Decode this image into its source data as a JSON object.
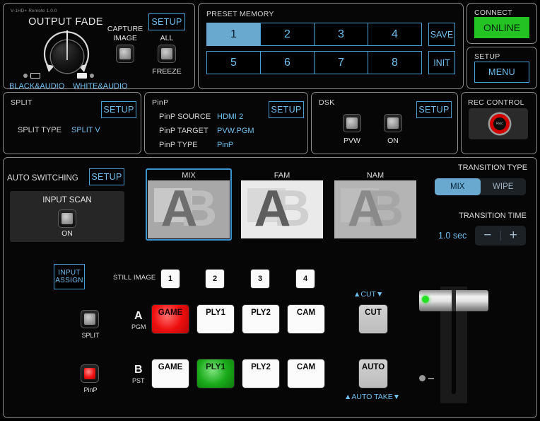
{
  "app": {
    "version": "V-1HD+ Remote 1.0.0"
  },
  "output_fade": {
    "title": "OUTPUT FADE",
    "left_label": "BLACK&AUDIO",
    "right_label": "WHITE&AUDIO"
  },
  "capture": {
    "line1": "CAPTURE",
    "line2": "IMAGE"
  },
  "freeze": {
    "setup_label": "SETUP",
    "all_label": "ALL",
    "freeze_label": "FREEZE"
  },
  "preset_memory": {
    "title": "PRESET MEMORY",
    "buttons": [
      "1",
      "2",
      "3",
      "4",
      "5",
      "6",
      "7",
      "8"
    ],
    "selected": "1",
    "save_label": "SAVE",
    "init_label": "INIT"
  },
  "connect": {
    "title": "CONNECT",
    "status": "ONLINE",
    "status_color": "#22c322"
  },
  "setup_menu": {
    "title": "SETUP",
    "menu_label": "MENU"
  },
  "split": {
    "title": "SPLIT",
    "setup_label": "SETUP",
    "type_key": "SPLIT TYPE",
    "type_value": "SPLIT V"
  },
  "pinp": {
    "title": "PinP",
    "setup_label": "SETUP",
    "rows": [
      {
        "key": "PinP SOURCE",
        "value": "HDMI 2"
      },
      {
        "key": "PinP TARGET",
        "value": "PVW.PGM"
      },
      {
        "key": "PinP TYPE",
        "value": "PinP"
      }
    ]
  },
  "dsk": {
    "title": "DSK",
    "setup_label": "SETUP",
    "pvw_label": "PVW",
    "on_label": "ON"
  },
  "rec_control": {
    "title": "REC CONTROL",
    "rec_label": "Rec"
  },
  "auto_switching": {
    "title": "AUTO SWITCHING",
    "setup_label": "SETUP",
    "input_scan_label": "INPUT SCAN",
    "state_label": "ON"
  },
  "transition_previews": [
    {
      "label": "MIX",
      "selected": true
    },
    {
      "label": "FAM",
      "selected": false
    },
    {
      "label": "NAM",
      "selected": false
    }
  ],
  "transition_type": {
    "title": "TRANSITION TYPE",
    "options": [
      "MIX",
      "WIPE"
    ],
    "selected": "MIX"
  },
  "transition_time": {
    "title": "TRANSITION TIME",
    "value": "1.0 sec",
    "minus_label": "−",
    "plus_label": "+"
  },
  "input_assign": {
    "line1": "INPUT",
    "line2": "ASSIGN"
  },
  "still_image": {
    "label": "STILL IMAGE",
    "buttons": [
      "1",
      "2",
      "3",
      "4"
    ]
  },
  "bus_a": {
    "letter": "A",
    "sub": "PGM",
    "side_label": "SPLIT",
    "side_on": false,
    "sources": [
      {
        "label": "GAME",
        "state": "on-red"
      },
      {
        "label": "PLY1",
        "state": "off"
      },
      {
        "label": "PLY2",
        "state": "off"
      },
      {
        "label": "CAM",
        "state": "off"
      }
    ]
  },
  "bus_b": {
    "letter": "B",
    "sub": "PST",
    "side_label": "PinP",
    "side_on": true,
    "sources": [
      {
        "label": "GAME",
        "state": "off"
      },
      {
        "label": "PLY1",
        "state": "on-green"
      },
      {
        "label": "PLY2",
        "state": "off"
      },
      {
        "label": "CAM",
        "state": "off"
      }
    ]
  },
  "cut": {
    "arrows": "▲CUT▼",
    "label": "CUT"
  },
  "auto": {
    "label": "AUTO",
    "arrows": "▲AUTO TAKE▼"
  },
  "colors": {
    "accent_blue": "#6fc0ef",
    "select_blue": "#6aa9cf",
    "online_green": "#22c322",
    "rec_red": "#d40000"
  }
}
